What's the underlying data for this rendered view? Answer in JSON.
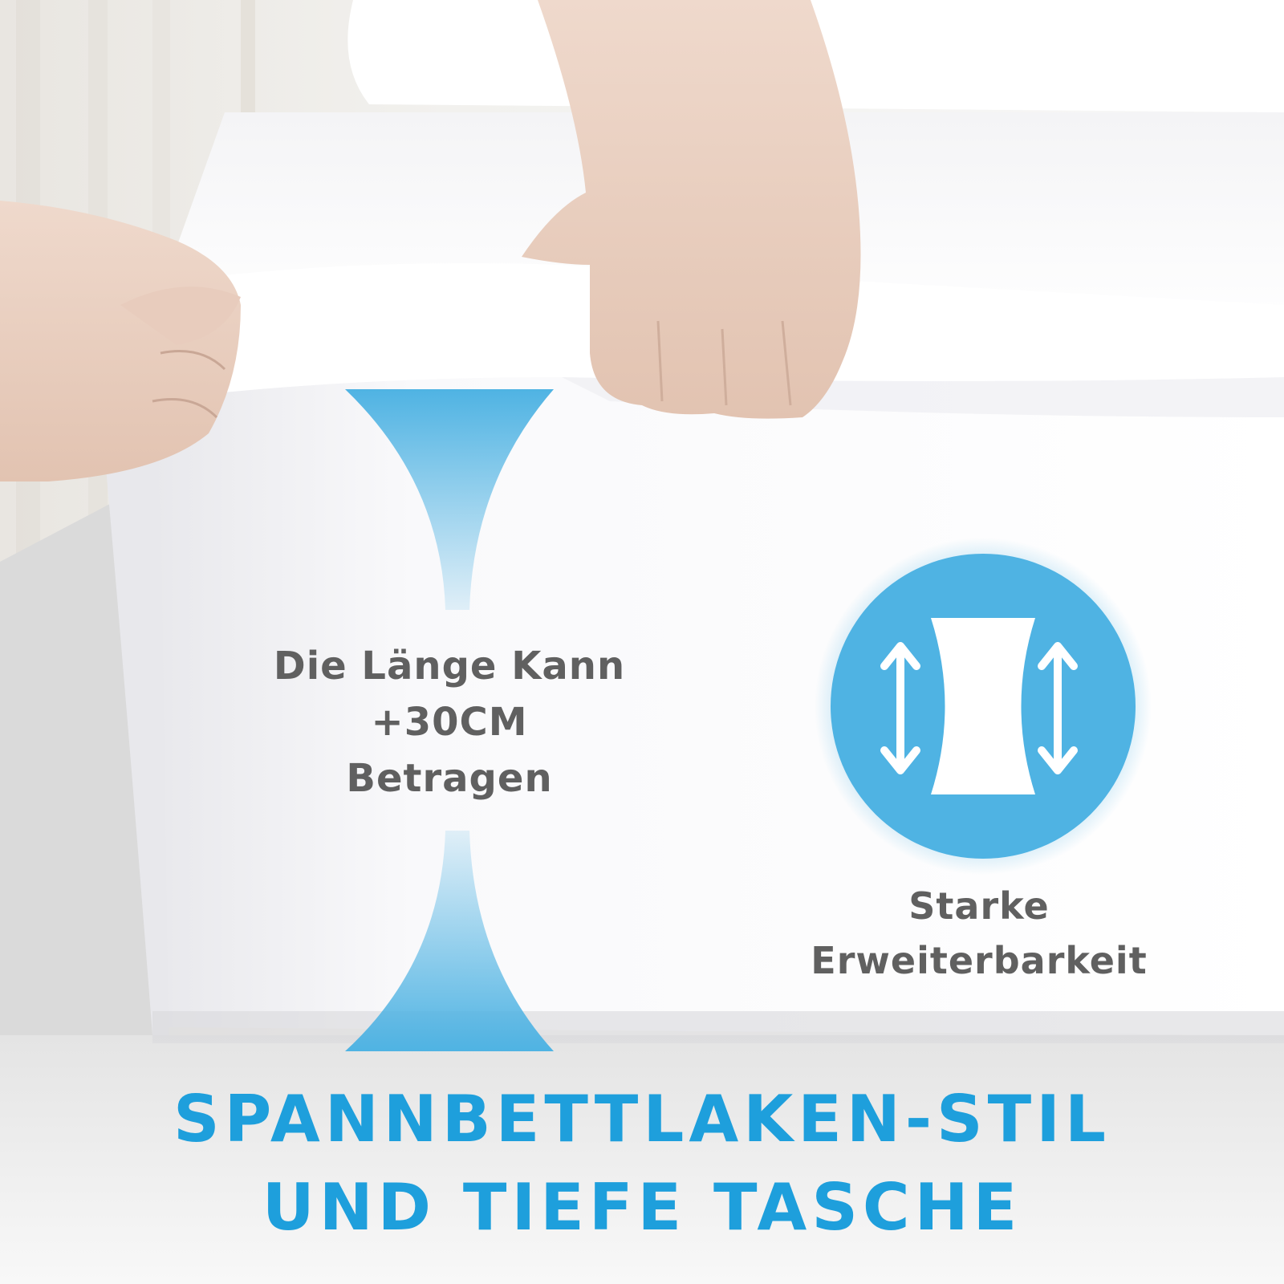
{
  "feature_length": {
    "lines": [
      "Die Länge Kann",
      "+30CM",
      "Betragen"
    ]
  },
  "feature_stretch": {
    "lines": [
      "Starke",
      "Erweiterbarkeit"
    ]
  },
  "headline": {
    "lines": [
      "SPANNBETTLAKEN-STIL",
      "UND TIEFE TASCHE"
    ]
  },
  "colors": {
    "accent_blue": "#4fb3e3",
    "headline_blue": "#1e9fdc",
    "text_gray": "#606060",
    "sheet_white": "#ffffff"
  },
  "icons": [
    "stretch-fabric-icon",
    "double-arrow-icon"
  ]
}
